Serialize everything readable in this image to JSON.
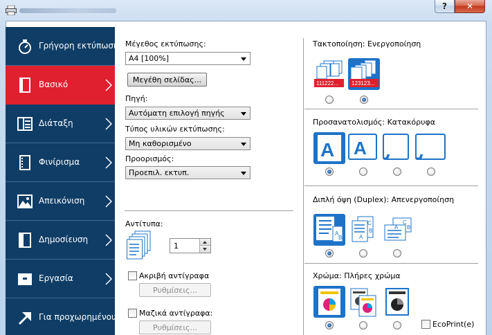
{
  "window": {
    "help": "?",
    "close": "✕"
  },
  "sidebar": {
    "items": [
      {
        "label": "Γρήγορη εκτύπωση",
        "icon": "stopwatch-icon"
      },
      {
        "label": "Βασικό",
        "icon": "page-icon",
        "active": true
      },
      {
        "label": "Διάταξη",
        "icon": "layout-icon"
      },
      {
        "label": "Φινίρισμα",
        "icon": "finishing-icon"
      },
      {
        "label": "Απεικόνιση",
        "icon": "image-icon"
      },
      {
        "label": "Δημοσίευση",
        "icon": "publishing-icon"
      },
      {
        "label": "Εργασία",
        "icon": "job-icon"
      },
      {
        "label": "Για προχωρημένους",
        "icon": "arrow-icon"
      }
    ]
  },
  "basic": {
    "print_size_label": "Μέγεθος εκτύπωσης:",
    "print_size_value": "A4  [100%]",
    "page_sizes_button": "Μεγέθη σελίδας...",
    "source_label": "Πηγή:",
    "source_value": "Αυτόματη επιλογή πηγής",
    "media_label": "Τύπος υλικών εκτύπωσης:",
    "media_value": "Μη καθορισμένο",
    "dest_label": "Προορισμός:",
    "dest_value": "Προεπιλ. εκτυπ.",
    "copies_label": "Αντίτυπα:",
    "copies_value": "1",
    "proof_label": "Ακριβή αντίγραφα",
    "proof_settings": "Ρυθμίσεις...",
    "mass_label": "Μαζικά αντίγραφα:",
    "mass_settings": "Ρυθμίσεις..."
  },
  "collate": {
    "label": "Τακτοποίηση:",
    "value": "Ενεργοποίηση",
    "opt1_text": "111222...",
    "opt2_text": "123123..."
  },
  "orientation": {
    "label": "Προσανατολισμός:",
    "value": "Κατακόρυφα"
  },
  "duplex": {
    "label": "Διπλή όψη (Duplex):",
    "value": "Απενεργοποίηση"
  },
  "color": {
    "label": "Χρώμα:",
    "value": "Πλήρες χρώμα",
    "ecoprint": "EcoPrint(e)"
  },
  "colors": {
    "sidebar": "#0f3d66",
    "active": "#e0202f",
    "select_tile": "#1e73c8"
  }
}
